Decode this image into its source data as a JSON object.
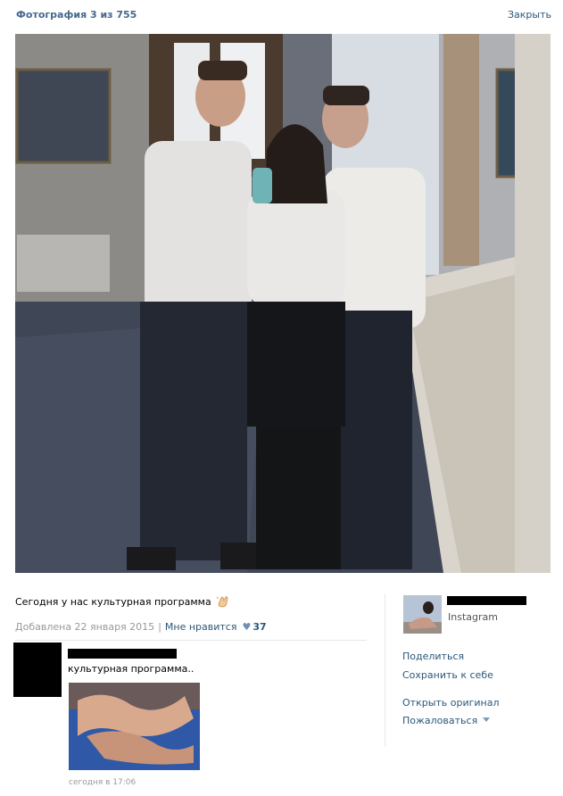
{
  "header": {
    "title": "Фотография 3 из 755",
    "close_label": "Закрыть"
  },
  "photo": {
    "caption": "Сегодня у нас культурная программа",
    "caption_emoji_icon": "clapping-hands-icon",
    "added": "Добавлена 22 января 2015",
    "like_label": "Мне нравится",
    "like_icon": "heart-icon",
    "likes": "37"
  },
  "comment": {
    "text": "культурная программа..",
    "time": "сегодня в 17:06"
  },
  "owner": {
    "source": "Instagram"
  },
  "actions": {
    "share": "Поделиться",
    "save": "Сохранить к себе",
    "open_original": "Открыть оригинал",
    "report": "Пожаловаться"
  },
  "colors": {
    "link": "#2b587a",
    "title": "#45688e",
    "muted": "#999999",
    "heart": "#6d8fb3"
  }
}
